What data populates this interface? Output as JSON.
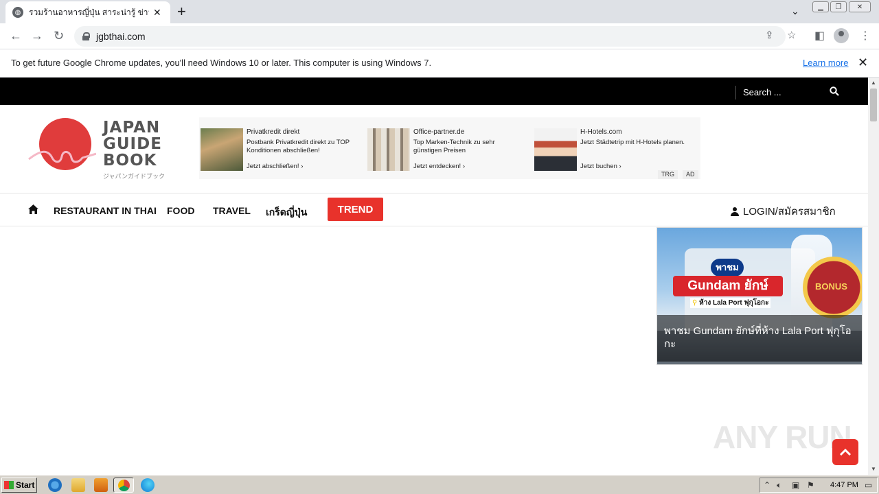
{
  "browser": {
    "tab_title": "รวมร้านอาหารญี่ปุ่น สาระน่ารู้ ข่าวสาร ส",
    "url": "jgbthai.com",
    "new_tab": "+",
    "infobar_message": "To get future Google Chrome updates, you'll need Windows 10 or later. This computer is using Windows 7.",
    "infobar_link": "Learn more"
  },
  "site": {
    "search_placeholder": "Search ...",
    "logo_text": "JAPAN\nGUIDE\nBOOK",
    "logo_subtext": "ジャパンガイドブック",
    "nav": [
      "RESTAURANT IN THAI",
      "FOOD",
      "TRAVEL",
      "เกร็ดญี่ปุ่น"
    ],
    "trend_label": "TREND",
    "login_label": "LOGIN/สมัครสมาชิก",
    "ads": [
      {
        "brand": "Privatkredit direkt",
        "desc": "Postbank Privatkredit direkt zu TOP Konditionen abschließen!",
        "cta": "Jetzt abschließen!  ›"
      },
      {
        "brand": "Office-partner.de",
        "desc": "Top Marken-Technik zu sehr günstigen Preisen",
        "cta": "Jetzt entdecken!  ›"
      },
      {
        "brand": "H-Hotels.com",
        "desc": "Jetzt Städtetrip mit H-Hotels planen.",
        "cta": "Jetzt buchen  ›"
      }
    ],
    "ad_tags": [
      "TRG",
      "AD"
    ],
    "feature": {
      "pill_small": "พาชม",
      "pill_big": "Gundam ยักษ์",
      "place": "ห้าง Lala Port ฟุกุโอกะ",
      "bonus": "BONUS",
      "caption": "พาชม Gundam ยักษ์ที่ห้าง Lala Port ฟุกุโอกะ"
    },
    "watermark": "ANY RUN"
  },
  "taskbar": {
    "start_label": "Start",
    "clock": "4:47 PM"
  },
  "colors": {
    "accent_red": "#e8322b",
    "topbar_black": "#000000"
  }
}
